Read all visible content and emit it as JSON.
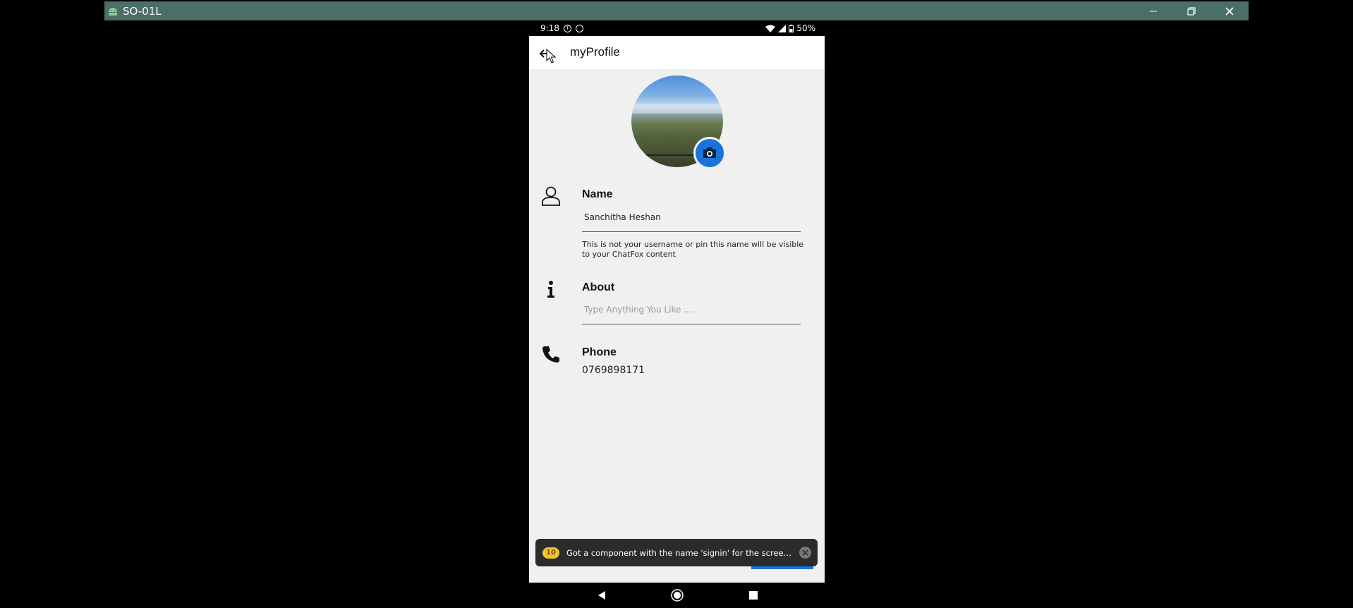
{
  "window": {
    "title": "SO-01L",
    "controls": [
      "minimize-icon",
      "restore-icon",
      "close-icon"
    ]
  },
  "status_bar": {
    "time": "9:18",
    "left_icons": [
      "facebook-icon",
      "messenger-icon"
    ],
    "battery": "50%"
  },
  "app_bar": {
    "title": "myProfile",
    "back_icon": "arrow-left-icon"
  },
  "profile": {
    "camera_icon": "camera-icon",
    "name": {
      "label": "Name",
      "value": "Sanchitha Heshan",
      "help": "This is not your username or pin this name will be visible to your ChatFox content"
    },
    "about": {
      "label": "About",
      "placeholder": "Type Anything You Like ...."
    },
    "phone": {
      "label": "Phone",
      "value": "0769898171"
    }
  },
  "toast": {
    "badge": "10",
    "message": "Got a component with the name 'signin' for the screen 'signup'"
  },
  "colors": {
    "accent": "#1a73d8",
    "background": "#f0f0f0",
    "titlebar": "#4a6f66"
  }
}
